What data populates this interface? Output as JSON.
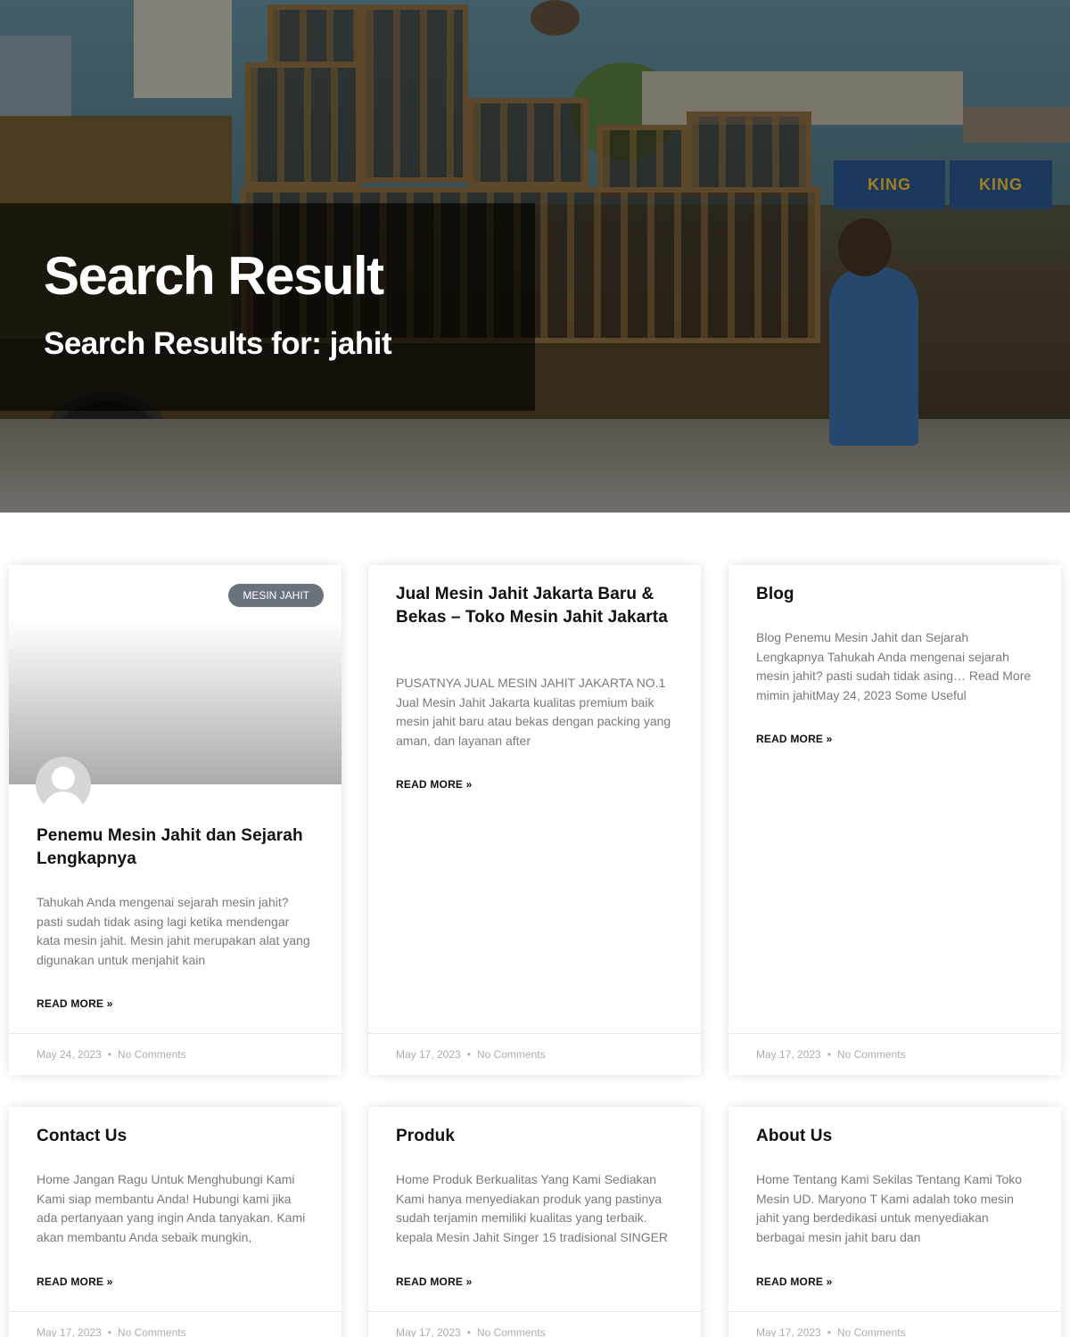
{
  "hero": {
    "title": "Search Result",
    "subtitle": "Search Results for: jahit",
    "sign_text": "KING"
  },
  "posts": [
    {
      "category": "MESIN JAHIT",
      "title": "Penemu Mesin Jahit dan Sejarah Lengkapnya",
      "excerpt": "Tahukah Anda mengenai sejarah mesin jahit? pasti sudah tidak asing lagi ketika mendengar kata mesin jahit. Mesin jahit merupakan alat yang digunakan untuk menjahit kain",
      "read_more": "READ MORE »",
      "date": "May 24, 2023",
      "comments": "No Comments"
    },
    {
      "title": "Jual Mesin Jahit Jakarta Baru & Bekas – Toko Mesin Jahit Jakarta",
      "excerpt": "PUSATNYA JUAL MESIN JAHIT JAKARTA NO.1 Jual Mesin Jahit Jakarta kualitas premium baik mesin jahit baru atau bekas dengan packing yang aman, dan layanan after",
      "read_more": "READ MORE »",
      "date": "May 17, 2023",
      "comments": "No Comments"
    },
    {
      "title": "Blog",
      "excerpt": "Blog Penemu Mesin Jahit dan Sejarah Lengkapnya Tahukah Anda mengenai sejarah mesin jahit? pasti sudah tidak asing… Read More mimin jahitMay 24, 2023 Some Useful",
      "read_more": "READ MORE »",
      "date": "May 17, 2023",
      "comments": "No Comments"
    },
    {
      "title": "Contact Us",
      "excerpt": "Home Jangan Ragu Untuk Menghubungi Kami Kami siap membantu Anda! Hubungi kami jika ada pertanyaan yang ingin Anda tanyakan. Kami akan membantu Anda sebaik mungkin,",
      "read_more": "READ MORE »",
      "date": "May 17, 2023",
      "comments": "No Comments"
    },
    {
      "title": "Produk",
      "excerpt": "Home Produk Berkualitas Yang Kami Sediakan Kami hanya menyediakan produk yang pastinya sudah terjamin memiliki kualitas yang terbaik. kepala Mesin Jahit Singer 15 tradisional SINGER",
      "read_more": "READ MORE »",
      "date": "May 17, 2023",
      "comments": "No Comments"
    },
    {
      "title": "About Us",
      "excerpt": "Home Tentang Kami Sekilas Tentang Kami Toko Mesin UD. Maryono T Kami adalah toko mesin jahit yang berdedikasi untuk menyediakan berbagai mesin jahit baru dan",
      "read_more": "READ MORE »",
      "date": "May 17, 2023",
      "comments": "No Comments"
    }
  ]
}
